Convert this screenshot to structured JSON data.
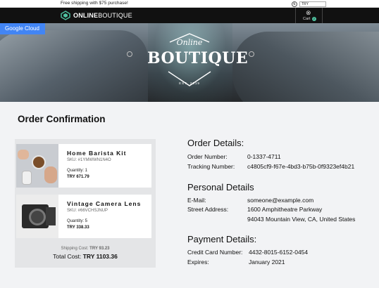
{
  "topbar": {
    "shipping_message": "Free shipping with $75 purchase!",
    "currency_symbol": "₺",
    "currency_selected": "TRY"
  },
  "nav": {
    "logo_bold": "ONLINE",
    "logo_thin": "BOUTIQUE",
    "cart_label": "Cart",
    "cart_count": "2"
  },
  "hero": {
    "badge": "Google Cloud",
    "logo_script": "Online",
    "logo_main": "BOUTIQUE",
    "logo_est": "EST. 2019"
  },
  "page_title": "Order Confirmation",
  "items": [
    {
      "name": "Home Barista Kit",
      "sku": "SKU: #1YMWWN1N4O",
      "quantity": "Quantity: 1",
      "price": "TRY 671.79"
    },
    {
      "name": "Vintage Camera Lens",
      "sku": "SKU: #66VCHSJNUP",
      "quantity": "Quantity: 5",
      "price": "TRY 338.33"
    }
  ],
  "totals": {
    "shipping_label": "Shipping Cost:",
    "shipping_value": "TRY 93.23",
    "total_label": "Total Cost:",
    "total_value": "TRY 1103.36"
  },
  "order_details": {
    "title": "Order Details:",
    "order_number_label": "Order Number:",
    "order_number": "0-1337-4711",
    "tracking_label": "Tracking Number:",
    "tracking_number": "c4805cf9-f67e-4bd3-b75b-0f9323ef4b21"
  },
  "personal_details": {
    "title": "Personal Details",
    "email_label": "E-Mail:",
    "email": "someone@example.com",
    "address_label": "Street Address:",
    "address_line1": "1600 Amphitheatre Parkway",
    "address_line2": "94043 Mountain View, CA, United States"
  },
  "payment_details": {
    "title": "Payment Details:",
    "card_label": "Credit Card Number:",
    "card_number": "4432-8015-6152-0454",
    "expires_label": "Expires:",
    "expires": "January 2021"
  }
}
